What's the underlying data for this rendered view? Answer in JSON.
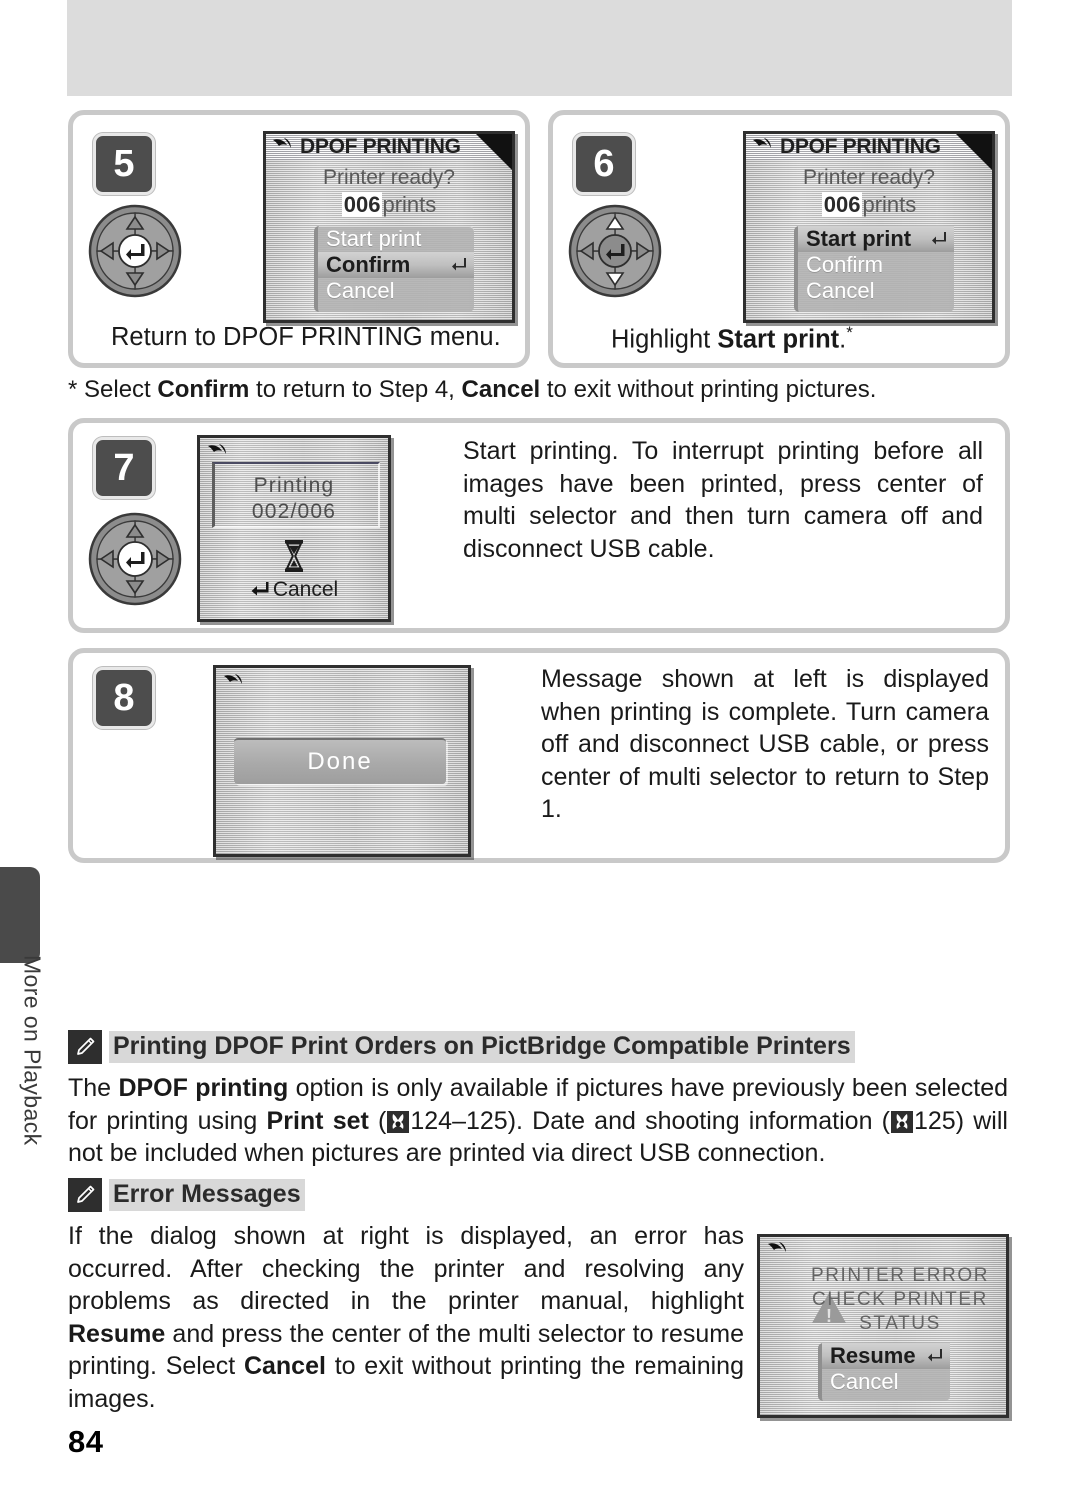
{
  "page": {
    "number": "84",
    "side_tab_label": "More on Playback"
  },
  "steps": [
    {
      "number": "5",
      "caption_plain": "Return to DPOF PRINTING menu.",
      "caption_prefix": "Return to DPOF PRINTING menu.",
      "screen": {
        "title": "DPOF PRINTING",
        "subtitle": "Printer ready?",
        "count": "006",
        "count_unit": "prints",
        "menu": [
          "Start print",
          "Confirm",
          "Cancel"
        ],
        "selected": "Confirm"
      }
    },
    {
      "number": "6",
      "caption_prefix": "Highlight ",
      "caption_bold": "Start print",
      "caption_suffix": ".",
      "caption_marker": "*",
      "screen": {
        "title": "DPOF PRINTING",
        "subtitle": "Printer ready?",
        "count": "006",
        "count_unit": "prints",
        "menu": [
          "Start print",
          "Confirm",
          "Cancel"
        ],
        "selected": "Start print"
      }
    },
    {
      "number": "7",
      "text": "Start printing.  To interrupt printing before all images have been printed, press center of multi selector and then turn camera off and disconnect USB cable.",
      "screen": {
        "status": "Printing",
        "progress": "002/006",
        "cancel_label": "Cancel"
      }
    },
    {
      "number": "8",
      "text": "Message shown at left is displayed when printing is complete.  Turn camera off and disconnect USB cable, or press center of multi selector to return to Step 1.",
      "screen": {
        "message": "Done"
      }
    }
  ],
  "footnote": {
    "marker": "*",
    "part1": " Select ",
    "bold1": "Confirm",
    "part2": " to return to Step 4, ",
    "bold2": "Cancel",
    "part3": " to exit without printing pictures."
  },
  "notes": [
    {
      "title": "Printing DPOF Print Orders on PictBridge Compatible Printers",
      "icon": "pencil-icon",
      "body_part1": "The ",
      "body_bold1": "DPOF printing",
      "body_part2": " option is only available if pictures have previously been selected for printing using ",
      "body_bold2": "Print set",
      "body_part3": " (",
      "ref1": "124–125",
      "body_part4": ").  Date and shooting information (",
      "ref2": "125",
      "body_part5": ") will not be included when pictures are printed via direct USB connection."
    },
    {
      "title": "Error Messages",
      "icon": "pencil-icon",
      "body_part1": "If the dialog shown at right is displayed, an error has occurred. After checking the printer and resolving any problems as directed in the printer manual, highlight ",
      "body_bold1": "Resume",
      "body_part2": " and press the center of the multi selector to resume printing.  Select ",
      "body_bold2": "Cancel",
      "body_part3": " to exit without printing the remaining images."
    }
  ],
  "error_dialog": {
    "line1": "PRINTER ERROR",
    "line2": "CHECK PRINTER",
    "line3": "STATUS",
    "menu": [
      "Resume",
      "Cancel"
    ],
    "selected": "Resume"
  },
  "colors": {
    "badge_bg": "#4d4d4d",
    "panel_border": "#c9c9c9",
    "header_band": "#dcdcdc",
    "note_highlight": "#d8d8d8"
  }
}
